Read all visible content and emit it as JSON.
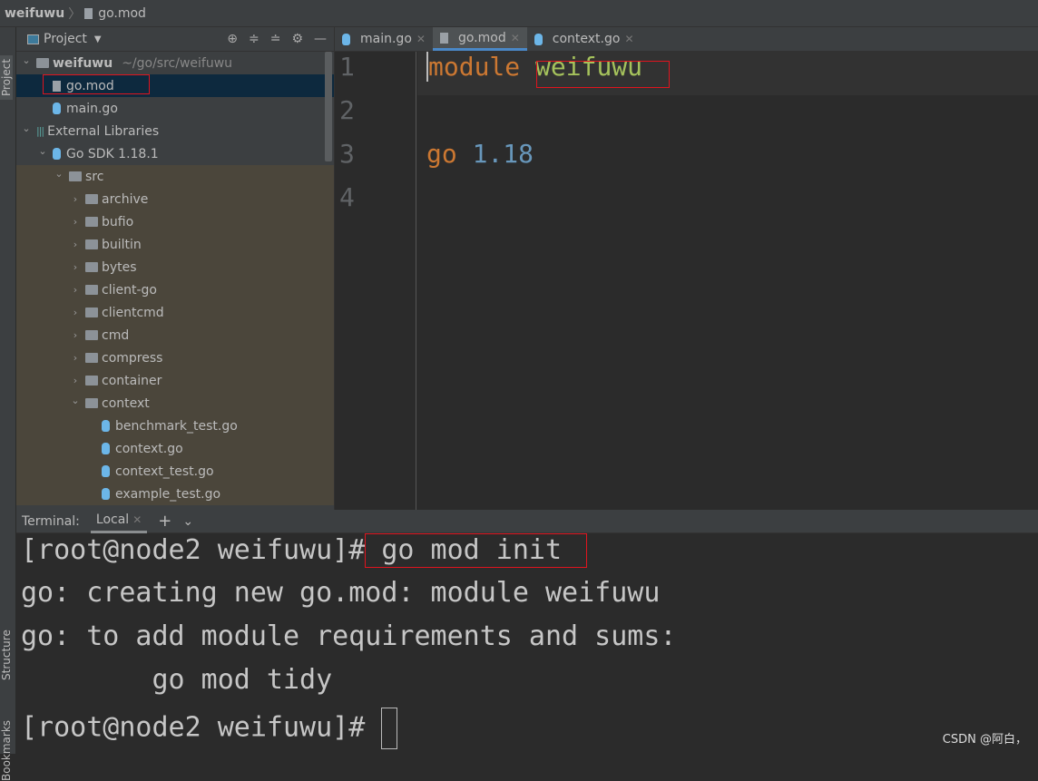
{
  "breadcrumb": {
    "project": "weifuwu",
    "file": "go.mod"
  },
  "left_strip": {
    "project": "Project",
    "structure": "Structure",
    "bookmarks": "Bookmarks"
  },
  "project_panel": {
    "title": "Project",
    "tree": [
      {
        "label": "weifuwu",
        "path": "~/go/src/weifuwu",
        "depth": 0,
        "type": "folder",
        "expanded": true
      },
      {
        "label": "go.mod",
        "depth": 1,
        "type": "file",
        "selected": true
      },
      {
        "label": "main.go",
        "depth": 1,
        "type": "go"
      },
      {
        "label": "External Libraries",
        "depth": 0,
        "type": "lib",
        "expanded": true
      },
      {
        "label": "Go SDK 1.18.1",
        "depth": 1,
        "type": "go",
        "expanded": true
      },
      {
        "label": "src",
        "depth": 2,
        "type": "folder",
        "expanded": true
      },
      {
        "label": "archive",
        "depth": 3,
        "type": "folder"
      },
      {
        "label": "bufio",
        "depth": 3,
        "type": "folder"
      },
      {
        "label": "builtin",
        "depth": 3,
        "type": "folder"
      },
      {
        "label": "bytes",
        "depth": 3,
        "type": "folder"
      },
      {
        "label": "client-go",
        "depth": 3,
        "type": "folder"
      },
      {
        "label": "clientcmd",
        "depth": 3,
        "type": "folder"
      },
      {
        "label": "cmd",
        "depth": 3,
        "type": "folder"
      },
      {
        "label": "compress",
        "depth": 3,
        "type": "folder"
      },
      {
        "label": "container",
        "depth": 3,
        "type": "folder"
      },
      {
        "label": "context",
        "depth": 3,
        "type": "folder",
        "expanded": true
      },
      {
        "label": "benchmark_test.go",
        "depth": 4,
        "type": "go"
      },
      {
        "label": "context.go",
        "depth": 4,
        "type": "go"
      },
      {
        "label": "context_test.go",
        "depth": 4,
        "type": "go"
      },
      {
        "label": "example_test.go",
        "depth": 4,
        "type": "go"
      }
    ]
  },
  "tabs": [
    {
      "label": "main.go"
    },
    {
      "label": "go.mod",
      "active": true
    },
    {
      "label": "context.go"
    }
  ],
  "editor": {
    "line_numbers": [
      "1",
      "2",
      "3",
      "4"
    ],
    "line1": {
      "keyword": "module",
      "name": "weifuwu"
    },
    "line3": {
      "keyword": "go",
      "version": "1.18"
    }
  },
  "terminal": {
    "label": "Terminal:",
    "tab": "Local",
    "prompt": "[root@node2 weifuwu]#",
    "command": " go mod init ",
    "output": [
      "go: creating new go.mod: module weifuwu",
      "go: to add module requirements and sums:",
      "        go mod tidy"
    ]
  },
  "watermark": "CSDN @阿白，",
  "colors": {
    "keyword": "#cc7832",
    "string": "#a5c25c",
    "number": "#6897bb",
    "selection": "#0d293e",
    "highlight_box": "#e0141e"
  }
}
